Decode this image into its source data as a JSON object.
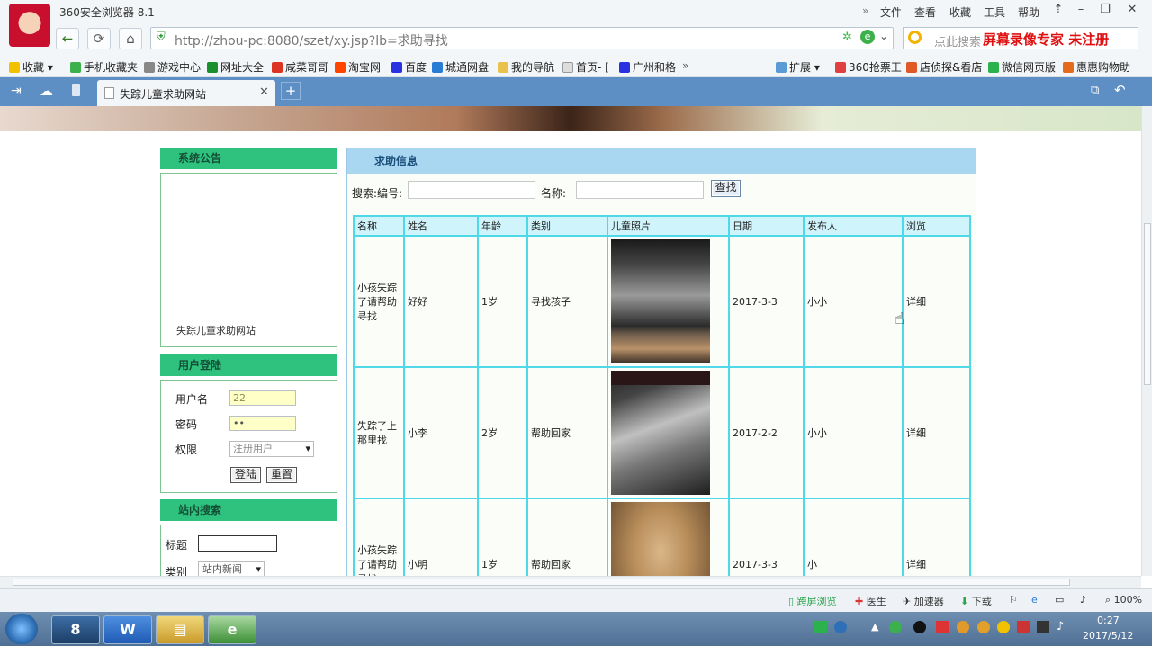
{
  "browser": {
    "title": "360安全浏览器 8.1",
    "menu": [
      "文件",
      "查看",
      "收藏",
      "工具",
      "帮助"
    ],
    "url": "http://zhou-pc:8080/szet/xy.jsp?lb=求助寻找",
    "search_placeholder": "点此搜索",
    "watermark": "屏幕录像专家 未注册",
    "favorites": [
      "收藏",
      "手机收藏夹",
      "游戏中心",
      "网址大全",
      "咸菜哥哥",
      "淘宝网",
      "百度",
      "城通网盘",
      "我的导航",
      "首页- [",
      "广州和格"
    ],
    "favorites_right": [
      "扩展",
      "360抢票王",
      "店侦探&看店",
      "微信网页版",
      "惠惠购物助"
    ],
    "tab_label": "失踪儿童求助网站",
    "colors": {
      "accent_green": "#2ec27e",
      "tab_bar": "#5d8fc4",
      "table_border": "#4ed8e8"
    }
  },
  "sidebar": {
    "notice": {
      "title": "系统公告",
      "scroll_text": "失踪儿童求助网站"
    },
    "login": {
      "title": "用户登陆",
      "username_label": "用户名",
      "username_value": "22",
      "password_label": "密码",
      "password_value": "••",
      "role_label": "权限",
      "role_value": "注册用户",
      "login_btn": "登陆",
      "reset_btn": "重置"
    },
    "site_search": {
      "title": "站内搜索",
      "title_label": "标题",
      "category_label": "类别",
      "category_value": "站内新闻"
    }
  },
  "main": {
    "title": "求助信息",
    "search_label": "搜索:编号:",
    "name_label": "名称:",
    "search_btn": "查找",
    "columns": [
      "名称",
      "姓名",
      "年龄",
      "类别",
      "儿童照片",
      "日期",
      "发布人",
      "浏览"
    ],
    "rows": [
      {
        "name": "小孩失踪了请帮助寻找",
        "person": "好好",
        "age": "1岁",
        "category": "寻找孩子",
        "date": "2017-3-3",
        "publisher": "小小",
        "action": "详细"
      },
      {
        "name": "失踪了上那里找",
        "person": "小李",
        "age": "2岁",
        "category": "帮助回家",
        "date": "2017-2-2",
        "publisher": "小小",
        "action": "详细"
      },
      {
        "name": "小孩失踪了请帮助寻找",
        "person": "小明",
        "age": "1岁",
        "category": "帮助回家",
        "date": "2017-3-3",
        "publisher": "小",
        "action": "详细"
      }
    ]
  },
  "statusbar": {
    "items": [
      "跨屏浏览",
      "医生",
      "加速器",
      "下载"
    ],
    "zoom": "100%"
  },
  "taskbar": {
    "time": "0:27",
    "date": "2017/5/12"
  }
}
